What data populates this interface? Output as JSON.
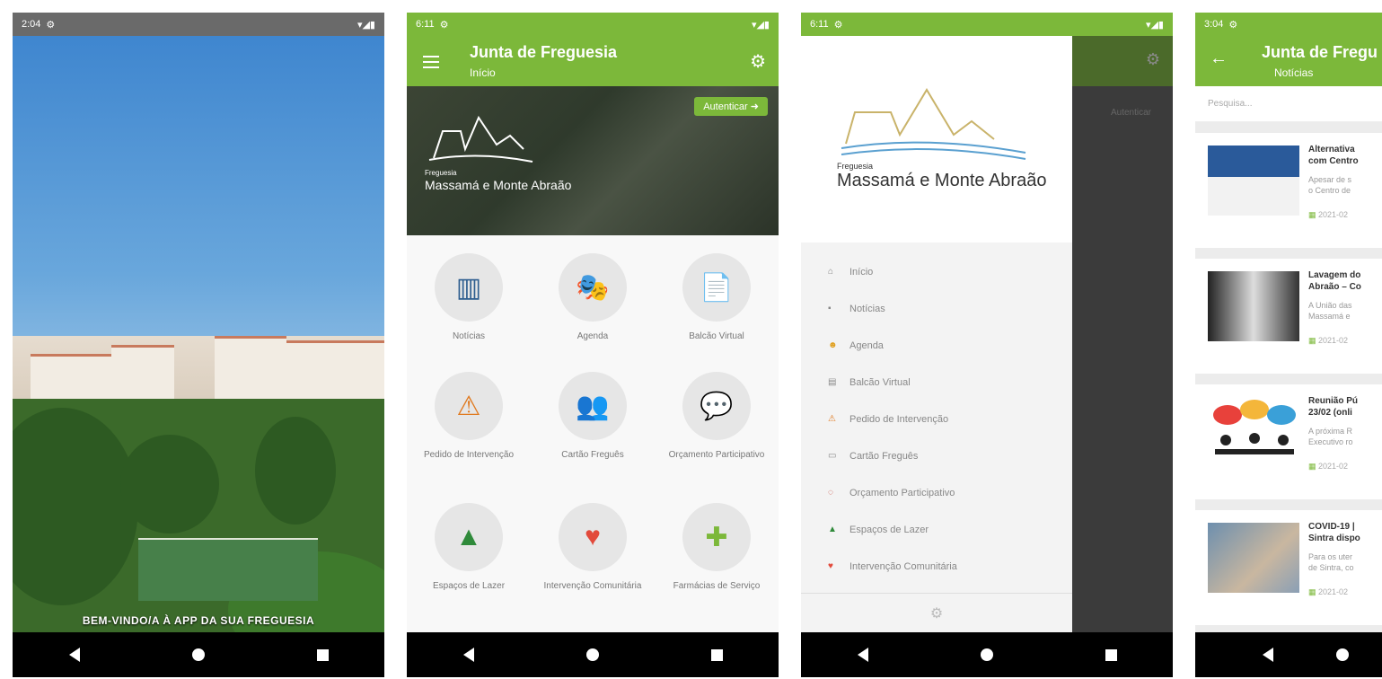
{
  "colors": {
    "brand_green": "#7cb83a",
    "status_grey": "#6a6a6a"
  },
  "screen1": {
    "status": {
      "time": "2:04"
    },
    "welcome": "BEM-VINDO/A À APP DA SUA FREGUESIA"
  },
  "screen2": {
    "status": {
      "time": "6:11"
    },
    "title": "Junta de Freguesia",
    "subtitle": "Início",
    "auth_button": "Autenticar",
    "logo": {
      "line1": "Freguesia",
      "line2": "Massamá e Monte Abraão"
    },
    "tiles": [
      {
        "label": "Notícias",
        "icon": "news-icon",
        "glyph": "▥"
      },
      {
        "label": "Agenda",
        "icon": "theatre-masks-icon",
        "glyph": "🎭"
      },
      {
        "label": "Balcão Virtual",
        "icon": "document-icon",
        "glyph": "📄"
      },
      {
        "label": "Pedido de Intervenção",
        "icon": "warning-pin-icon",
        "glyph": "⚠"
      },
      {
        "label": "Cartão Freguês",
        "icon": "people-card-icon",
        "glyph": "👥"
      },
      {
        "label": "Orçamento Participativo",
        "icon": "speech-bubble-icon",
        "glyph": "💬"
      },
      {
        "label": "Espaços de Lazer",
        "icon": "tree-icon",
        "glyph": "▲"
      },
      {
        "label": "Intervenção Comunitária",
        "icon": "heart-hand-icon",
        "glyph": "♥"
      },
      {
        "label": "Farmácias de Serviço",
        "icon": "first-aid-kit-icon",
        "glyph": "✚"
      }
    ]
  },
  "screen3": {
    "status": {
      "time": "6:11"
    },
    "logo": {
      "line1": "Freguesia",
      "line2": "Massamá e Monte Abraão"
    },
    "auth_button": "Autenticar",
    "menu": [
      {
        "label": "Início",
        "icon": "home-icon",
        "glyph": "⌂"
      },
      {
        "label": "Notícias",
        "icon": "news-icon",
        "glyph": "▪"
      },
      {
        "label": "Agenda",
        "icon": "masks-icon",
        "glyph": "☻"
      },
      {
        "label": "Balcão Virtual",
        "icon": "document-icon",
        "glyph": "▤"
      },
      {
        "label": "Pedido de Intervenção",
        "icon": "warning-icon",
        "glyph": "⚠"
      },
      {
        "label": "Cartão Freguês",
        "icon": "card-icon",
        "glyph": "▭"
      },
      {
        "label": "Orçamento Participativo",
        "icon": "bubble-icon",
        "glyph": "◌"
      },
      {
        "label": "Espaços de Lazer",
        "icon": "tree-icon",
        "glyph": "▲"
      },
      {
        "label": "Intervenção Comunitária",
        "icon": "heart-hand-icon",
        "glyph": "♥"
      }
    ]
  },
  "screen4": {
    "status": {
      "time": "3:04"
    },
    "title": "Junta de Fregu",
    "subtitle": "Notícias",
    "search_placeholder": "Pesquisa...",
    "news": [
      {
        "title": "Alternativa\ncom Centro",
        "snippet": "Apesar de s\no Centro de",
        "date": "2021-02"
      },
      {
        "title": "Lavagem do\nAbraão – Co",
        "snippet": "A União das\nMassamá e",
        "date": "2021-02"
      },
      {
        "title": "Reunião Pú\n23/02 (onli",
        "snippet": "A próxima R\nExecutivo ro",
        "date": "2021-02"
      },
      {
        "title": "COVID-19 |\nSintra dispo",
        "snippet": "Para os uter\nde Sintra, co",
        "date": "2021-02"
      }
    ]
  }
}
